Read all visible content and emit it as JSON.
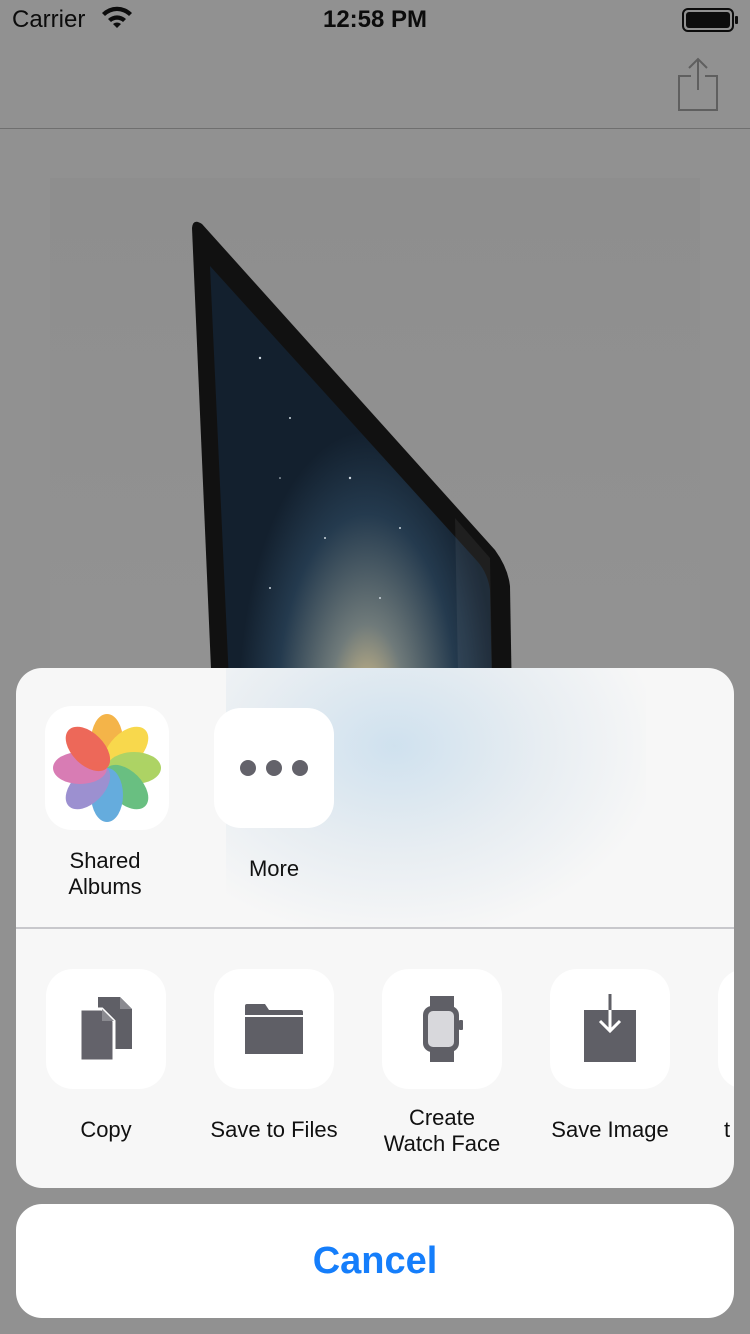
{
  "status_bar": {
    "carrier": "Carrier",
    "time": "12:58 PM"
  },
  "nav_bar": {
    "share_icon": "share-icon"
  },
  "share_sheet": {
    "apps": [
      {
        "label": "Shared\nAlbums",
        "icon": "photos-icon"
      },
      {
        "label": "More",
        "icon": "more-icon"
      }
    ],
    "actions": [
      {
        "label": "Copy",
        "icon": "copy-icon"
      },
      {
        "label": "Save to Files",
        "icon": "folder-icon"
      },
      {
        "label": "Create\nWatch Face",
        "icon": "watch-icon"
      },
      {
        "label": "Save Image",
        "icon": "save-image-icon"
      },
      {
        "label": "t",
        "icon": "partial-icon"
      }
    ],
    "cancel_label": "Cancel"
  },
  "colors": {
    "accent": "#157efb",
    "dim_background": "#919191",
    "sheet_background": "#f7f7f7"
  }
}
